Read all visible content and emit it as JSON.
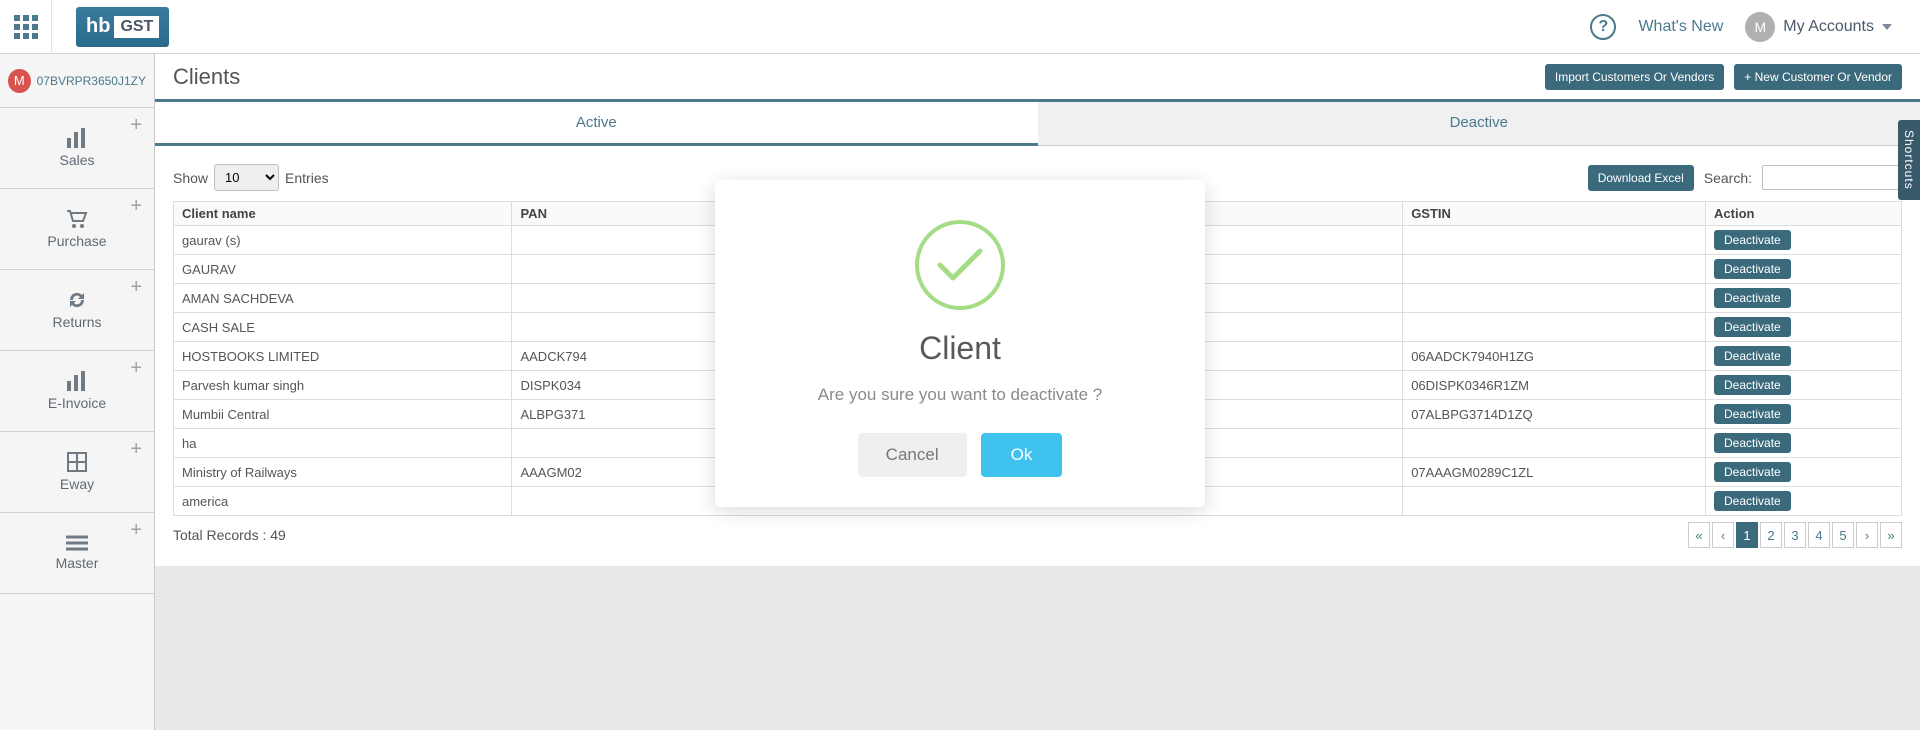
{
  "header": {
    "logo_hb": "hb",
    "logo_gst": "GST",
    "whats_new": "What's New",
    "avatar_letter": "M",
    "my_accounts": "My Accounts"
  },
  "tenant": {
    "badge": "M",
    "id": "07BVRPR3650J1ZY"
  },
  "sidebar": {
    "items": [
      {
        "label": "Sales"
      },
      {
        "label": "Purchase"
      },
      {
        "label": "Returns"
      },
      {
        "label": "E-Invoice"
      },
      {
        "label": "Eway"
      },
      {
        "label": "Master"
      }
    ]
  },
  "page": {
    "title": "Clients",
    "import_btn": "Import Customers Or Vendors",
    "new_btn": "+ New Customer Or Vendor"
  },
  "tabs": {
    "active": "Active",
    "deactive": "Deactive"
  },
  "table_controls": {
    "show": "Show",
    "entries": "Entries",
    "page_size": "10",
    "download_excel": "Download Excel",
    "search_label": "Search:"
  },
  "columns": {
    "client_name": "Client name",
    "pan": "PAN",
    "gstin": "GSTIN",
    "action": "Action"
  },
  "rows": [
    {
      "name": "gaurav (s)",
      "pan": "",
      "gstin": "",
      "action": "Deactivate"
    },
    {
      "name": "GAURAV",
      "pan": "",
      "gstin": "",
      "action": "Deactivate"
    },
    {
      "name": "AMAN SACHDEVA",
      "pan": "",
      "gstin": "",
      "action": "Deactivate"
    },
    {
      "name": "CASH SALE",
      "pan": "",
      "gstin": "",
      "action": "Deactivate"
    },
    {
      "name": "HOSTBOOKS LIMITED",
      "pan": "AADCK794",
      "gstin": "06AADCK7940H1ZG",
      "action": "Deactivate"
    },
    {
      "name": "Parvesh kumar singh",
      "pan": "DISPK034",
      "gstin": "06DISPK0346R1ZM",
      "action": "Deactivate"
    },
    {
      "name": "Mumbii Central",
      "pan": "ALBPG371",
      "gstin": "07ALBPG3714D1ZQ",
      "action": "Deactivate"
    },
    {
      "name": "ha",
      "pan": "",
      "gstin": "",
      "action": "Deactivate"
    },
    {
      "name": "Ministry of Railways",
      "pan": "AAAGM02",
      "gstin": "07AAAGM0289C1ZL",
      "action": "Deactivate"
    },
    {
      "name": "america",
      "pan": "",
      "gstin": "",
      "action": "Deactivate"
    }
  ],
  "footer": {
    "total_label": "Total Records :",
    "total": "49"
  },
  "pagination": {
    "first": "«",
    "prev": "‹",
    "pages": [
      "1",
      "2",
      "3",
      "4",
      "5"
    ],
    "next": "›",
    "last": "»",
    "current": "1"
  },
  "shortcuts": "Shortcuts",
  "modal": {
    "title": "Client",
    "text": "Are you sure you want to deactivate ?",
    "cancel": "Cancel",
    "ok": "Ok"
  }
}
